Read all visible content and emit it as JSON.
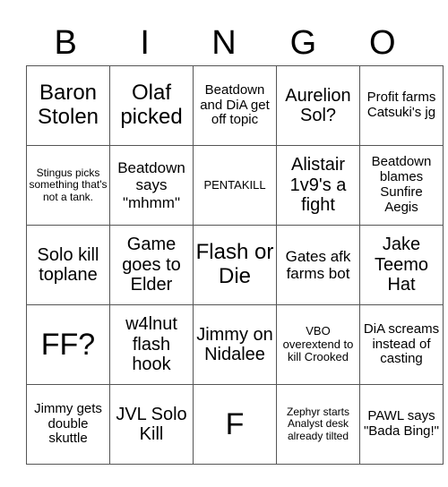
{
  "header": {
    "letters": [
      "B",
      "I",
      "N",
      "G",
      "O"
    ]
  },
  "board": {
    "rows": [
      [
        {
          "text": "Baron Stolen",
          "size": "l"
        },
        {
          "text": "Olaf picked",
          "size": "l"
        },
        {
          "text": "Beatdown and DiA get off topic",
          "size": "s"
        },
        {
          "text": "Aurelion Sol?",
          "size": "ml"
        },
        {
          "text": "Profit farms Catsuki's jg",
          "size": "s"
        }
      ],
      [
        {
          "text": "Stingus picks something that's not a tank.",
          "size": "xxs"
        },
        {
          "text": "Beatdown says \"mhmm\"",
          "size": "m"
        },
        {
          "text": "PENTAKILL",
          "size": "xs"
        },
        {
          "text": "Alistair 1v9's a fight",
          "size": "ml"
        },
        {
          "text": "Beatdown blames Sunfire Aegis",
          "size": "s"
        }
      ],
      [
        {
          "text": "Solo kill toplane",
          "size": "ml"
        },
        {
          "text": "Game goes to Elder",
          "size": "ml"
        },
        {
          "text": "Flash or Die",
          "size": "l"
        },
        {
          "text": "Gates afk farms bot",
          "size": "m"
        },
        {
          "text": "Jake Teemo Hat",
          "size": "ml"
        }
      ],
      [
        {
          "text": "FF?",
          "size": "xl"
        },
        {
          "text": "w4lnut flash hook",
          "size": "ml"
        },
        {
          "text": "Jimmy on Nidalee",
          "size": "ml"
        },
        {
          "text": "VBO overextend to kill Crooked",
          "size": "xs"
        },
        {
          "text": "DiA screams instead of casting",
          "size": "s"
        }
      ],
      [
        {
          "text": "Jimmy gets double skuttle",
          "size": "s"
        },
        {
          "text": "JVL Solo Kill",
          "size": "ml"
        },
        {
          "text": "F",
          "size": "xl"
        },
        {
          "text": "Zephyr starts Analyst desk already tilted",
          "size": "xxs"
        },
        {
          "text": "PAWL says \"Bada Bing!\"",
          "size": "s"
        }
      ]
    ]
  }
}
